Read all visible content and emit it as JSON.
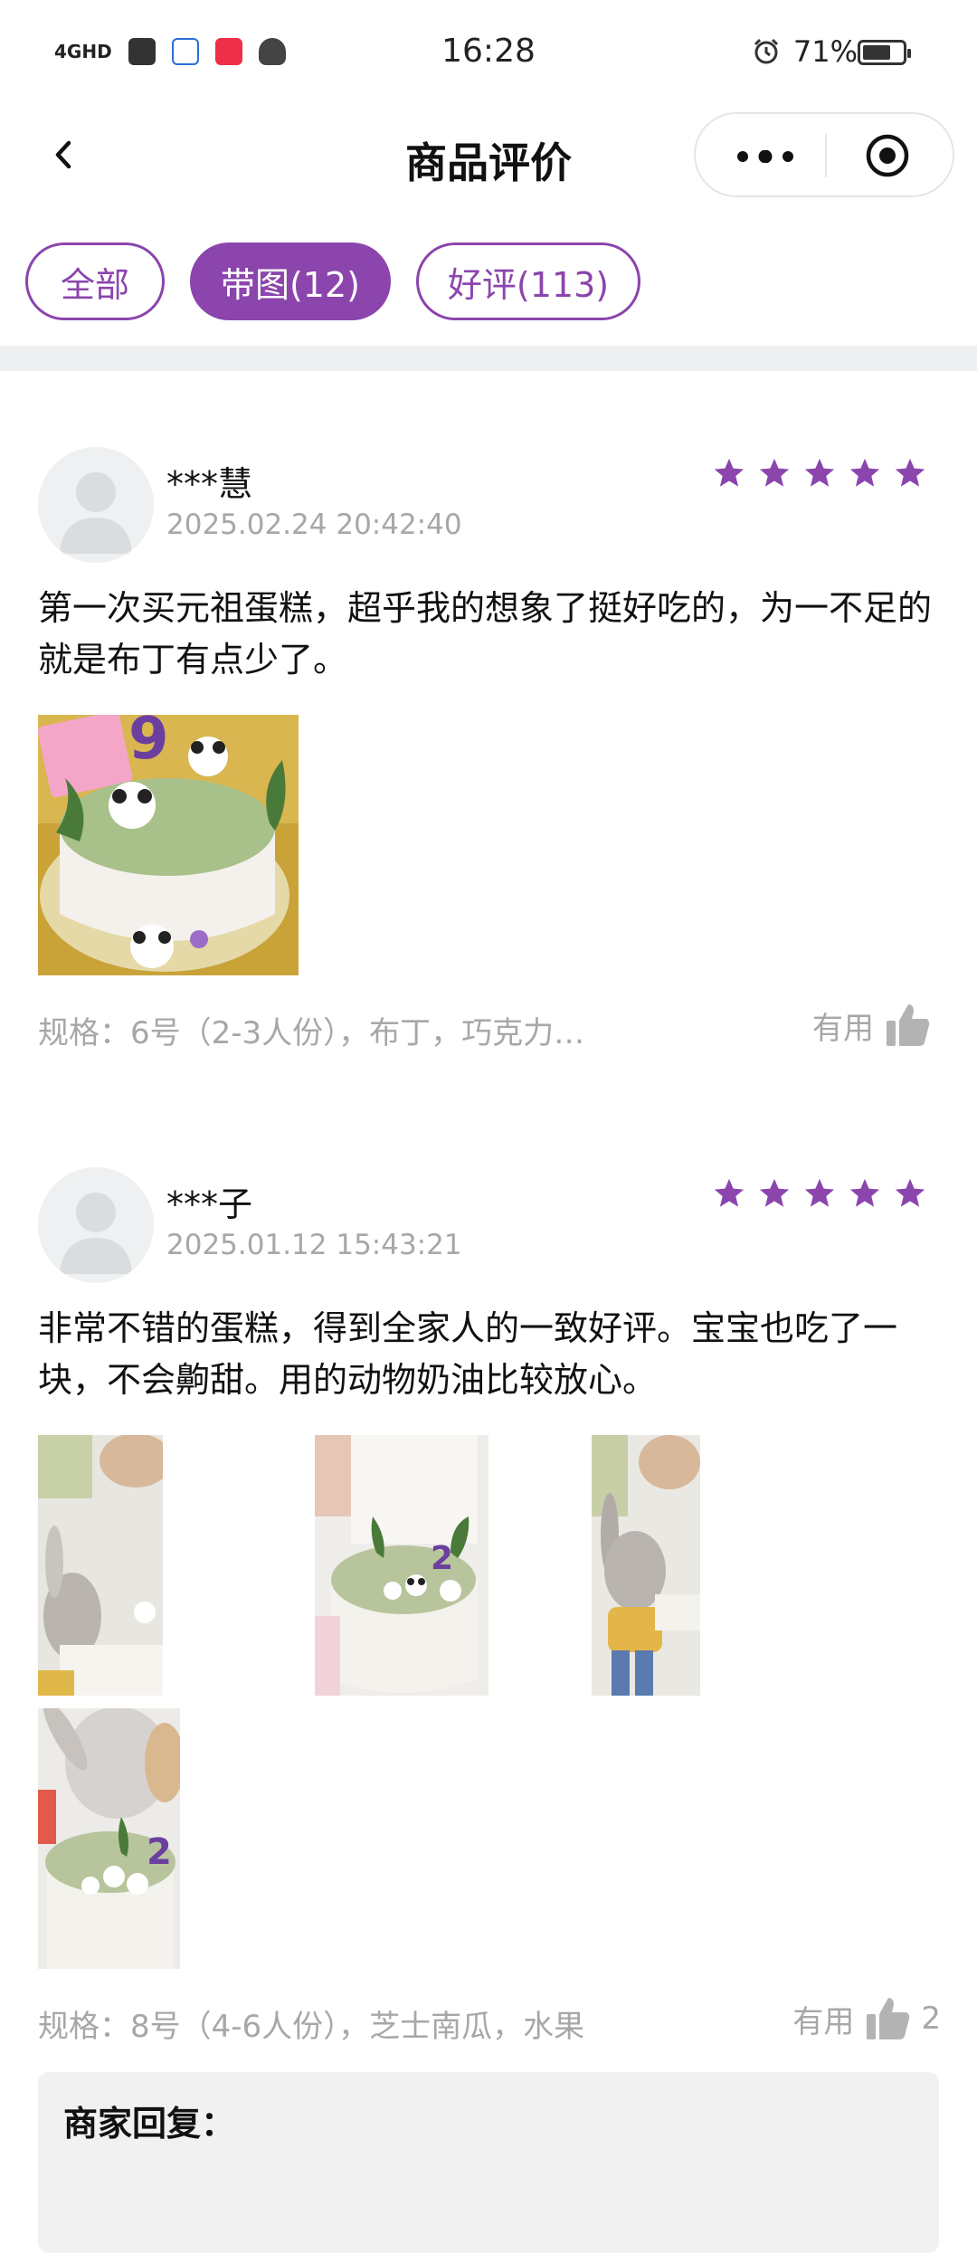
{
  "status_bar": {
    "network": "4GHD",
    "time": "16:28",
    "battery": "71%",
    "battery_level": 0.71,
    "app_icons": [
      "square-app-icon",
      "blue-app-icon",
      "red-app-icon",
      "bull-app-icon"
    ],
    "alarm_icon": "alarm-icon"
  },
  "nav": {
    "title": "商品评价",
    "back_icon": "back-arrow-icon",
    "menu_icon": "more-dots-icon",
    "close_icon": "target-circle-icon"
  },
  "tabs": [
    {
      "label": "全部",
      "active": false
    },
    {
      "label": "带图(12)",
      "active": true
    },
    {
      "label": "好评(113)",
      "active": false
    }
  ],
  "colors": {
    "accent": "#8b45ad",
    "meta_gray": "#a7a7a7",
    "divider": "#eeeff1"
  },
  "reviews": [
    {
      "user": "***慧",
      "date": "2025.02.24 20:42:40",
      "rating": 5,
      "text": "第一次买元祖蛋糕，超乎我的想象了挺好吃的，为一不足的就是布丁有点少了。",
      "photo_count": 1,
      "spec": "规格：6号（2-3人份），布丁，巧克力…",
      "useful_label": "有用",
      "useful_count": ""
    },
    {
      "user": "***子",
      "date": "2025.01.12 15:43:21",
      "rating": 5,
      "text": "非常不错的蛋糕，得到全家人的一致好评。宝宝也吃了一块，不会齁甜。用的动物奶油比较放心。",
      "photo_count": 4,
      "spec": "规格：8号（4-6人份），芝士南瓜，水果",
      "useful_label": "有用",
      "useful_count": "2"
    }
  ],
  "merchant_reply": {
    "title": "商家回复："
  }
}
